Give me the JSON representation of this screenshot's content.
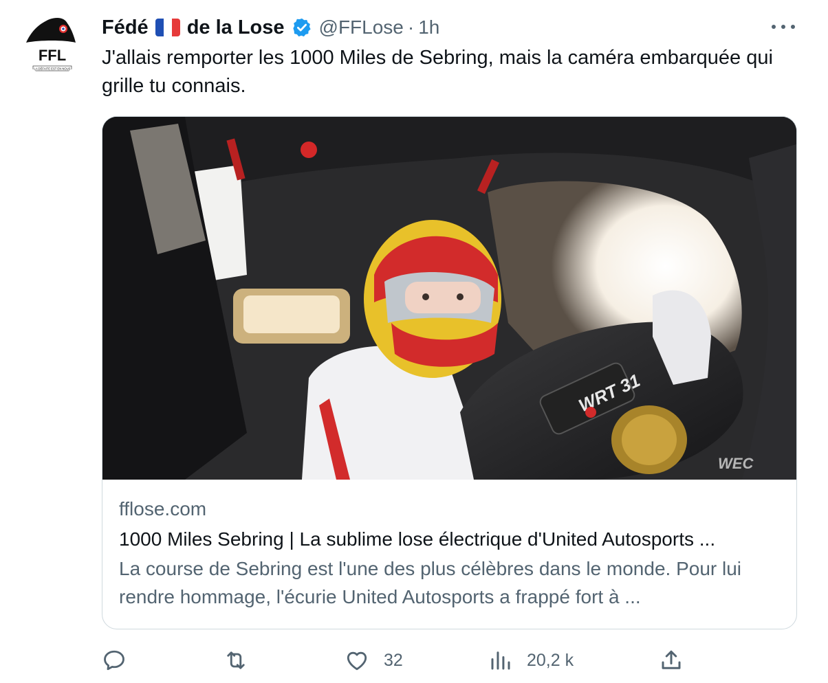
{
  "tweet": {
    "author": {
      "name_part1": "Fédé",
      "flag": "french-flag",
      "name_part2": "de la Lose",
      "handle": "@FFLose",
      "separator": "·",
      "time": "1h",
      "verified": true,
      "avatar": {
        "text": "FFL",
        "motto": "LA DÉFAITE EST EN NOUS"
      }
    },
    "text": "J'allais remporter les 1000 Miles de Sebring, mais la caméra embarquée qui grille tu connais.",
    "more_icon": "more-horizontal-icon",
    "card": {
      "media_description": "onboard-camera-race-car-cockpit",
      "watermark": "WEC",
      "car_decal": "WRT 31",
      "domain": "fflose.com",
      "title": "1000 Miles Sebring | La sublime lose électrique d'United Autosports ...",
      "description": "La course de Sebring est l'une des plus célèbres dans le monde. Pour lui rendre hommage, l'écurie United Autosports a frappé fort à ..."
    },
    "actions": {
      "reply": {
        "icon": "reply-icon",
        "count": ""
      },
      "retweet": {
        "icon": "retweet-icon",
        "count": ""
      },
      "like": {
        "icon": "heart-icon",
        "count": "32"
      },
      "views": {
        "icon": "views-icon",
        "count": "20,2 k"
      },
      "share": {
        "icon": "share-icon",
        "count": ""
      }
    }
  },
  "colors": {
    "text_primary": "#0f1419",
    "text_secondary": "#536471",
    "verified_blue": "#1d9bf0",
    "border": "#cfd9de"
  }
}
